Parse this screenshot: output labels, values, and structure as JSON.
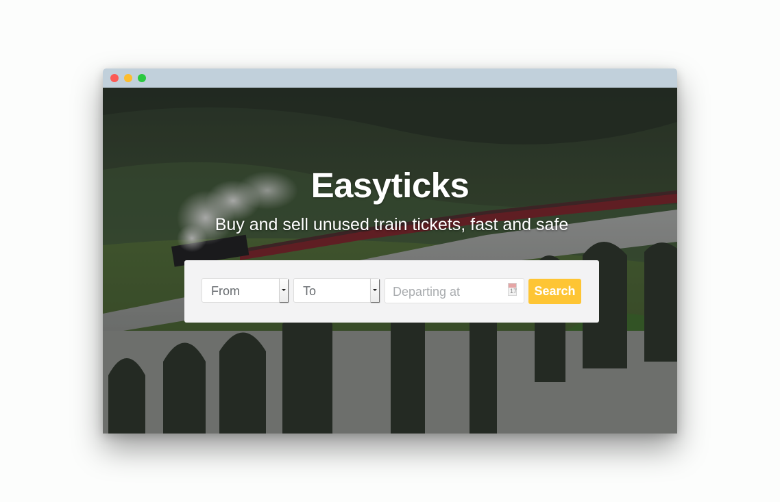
{
  "window": {
    "controls": [
      "close",
      "minimize",
      "maximize"
    ],
    "colors": {
      "close": "#fc5a55",
      "minimize": "#fdbd2e",
      "maximize": "#2ac940",
      "titlebar": "#c1d0db"
    }
  },
  "hero": {
    "title": "Easyticks",
    "subtitle": "Buy and sell unused train tickets, fast and safe",
    "background": "steam-train-on-viaduct-photo"
  },
  "search": {
    "from_value": "From",
    "to_value": "To",
    "date_placeholder": "Departing at",
    "calendar_day": "17",
    "button_label": "Search",
    "button_color": "#fec534"
  }
}
